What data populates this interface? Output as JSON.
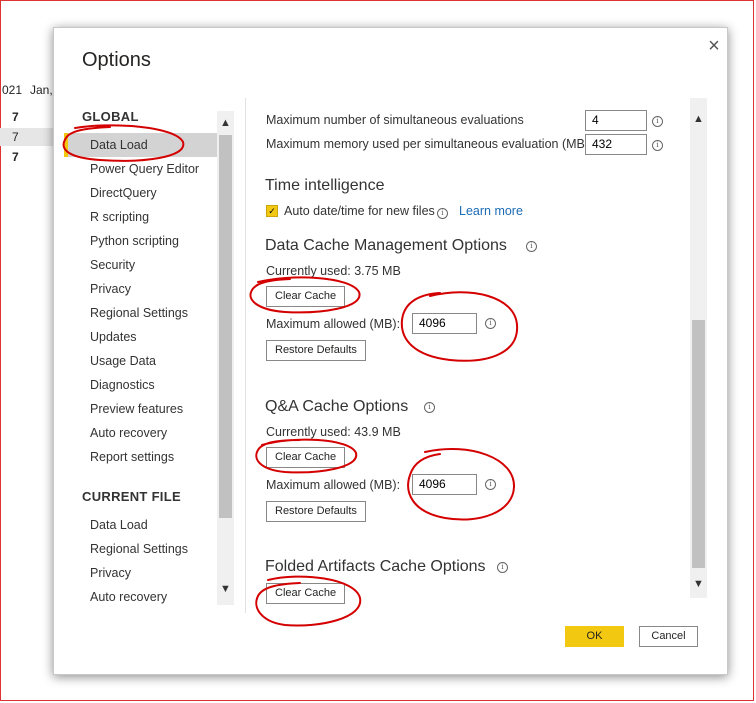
{
  "background": {
    "header_year": "021",
    "header_month": "Jan,",
    "rows": [
      "7",
      "7",
      "7"
    ]
  },
  "dialog": {
    "title": "Options",
    "close_glyph": "×",
    "ok_label": "OK",
    "cancel_label": "Cancel"
  },
  "nav": {
    "global_header": "GLOBAL",
    "global_items": [
      "Data Load",
      "Power Query Editor",
      "DirectQuery",
      "R scripting",
      "Python scripting",
      "Security",
      "Privacy",
      "Regional Settings",
      "Updates",
      "Usage Data",
      "Diagnostics",
      "Preview features",
      "Auto recovery",
      "Report settings"
    ],
    "current_header": "CURRENT FILE",
    "current_items": [
      "Data Load",
      "Regional Settings",
      "Privacy",
      "Auto recovery"
    ],
    "selected": "Data Load"
  },
  "content": {
    "max_evals_label": "Maximum number of simultaneous evaluations",
    "max_evals_value": "4",
    "max_mem_label": "Maximum memory used per simultaneous evaluation (MB)",
    "max_mem_value": "432",
    "time_intel_header": "Time intelligence",
    "auto_date_label": "Auto date/time for new files",
    "auto_date_checked": true,
    "learn_more": "Learn more",
    "data_cache_header": "Data Cache Management Options",
    "data_cache_used": "Currently used: 3.75 MB",
    "clear_cache": "Clear Cache",
    "max_allowed_label": "Maximum allowed (MB):",
    "data_cache_max": "4096",
    "restore_defaults": "Restore Defaults",
    "qa_cache_header": "Q&A Cache Options",
    "qa_cache_used": "Currently used: 43.9 MB",
    "qa_cache_max": "4096",
    "folded_header": "Folded Artifacts Cache Options"
  },
  "colors": {
    "accent": "#f2c811",
    "link": "#1b6bb5",
    "annotation": "#d40000"
  },
  "icons": [
    "close-icon",
    "info-icon",
    "chevron-up-icon",
    "chevron-down-icon",
    "checkmark-icon"
  ]
}
